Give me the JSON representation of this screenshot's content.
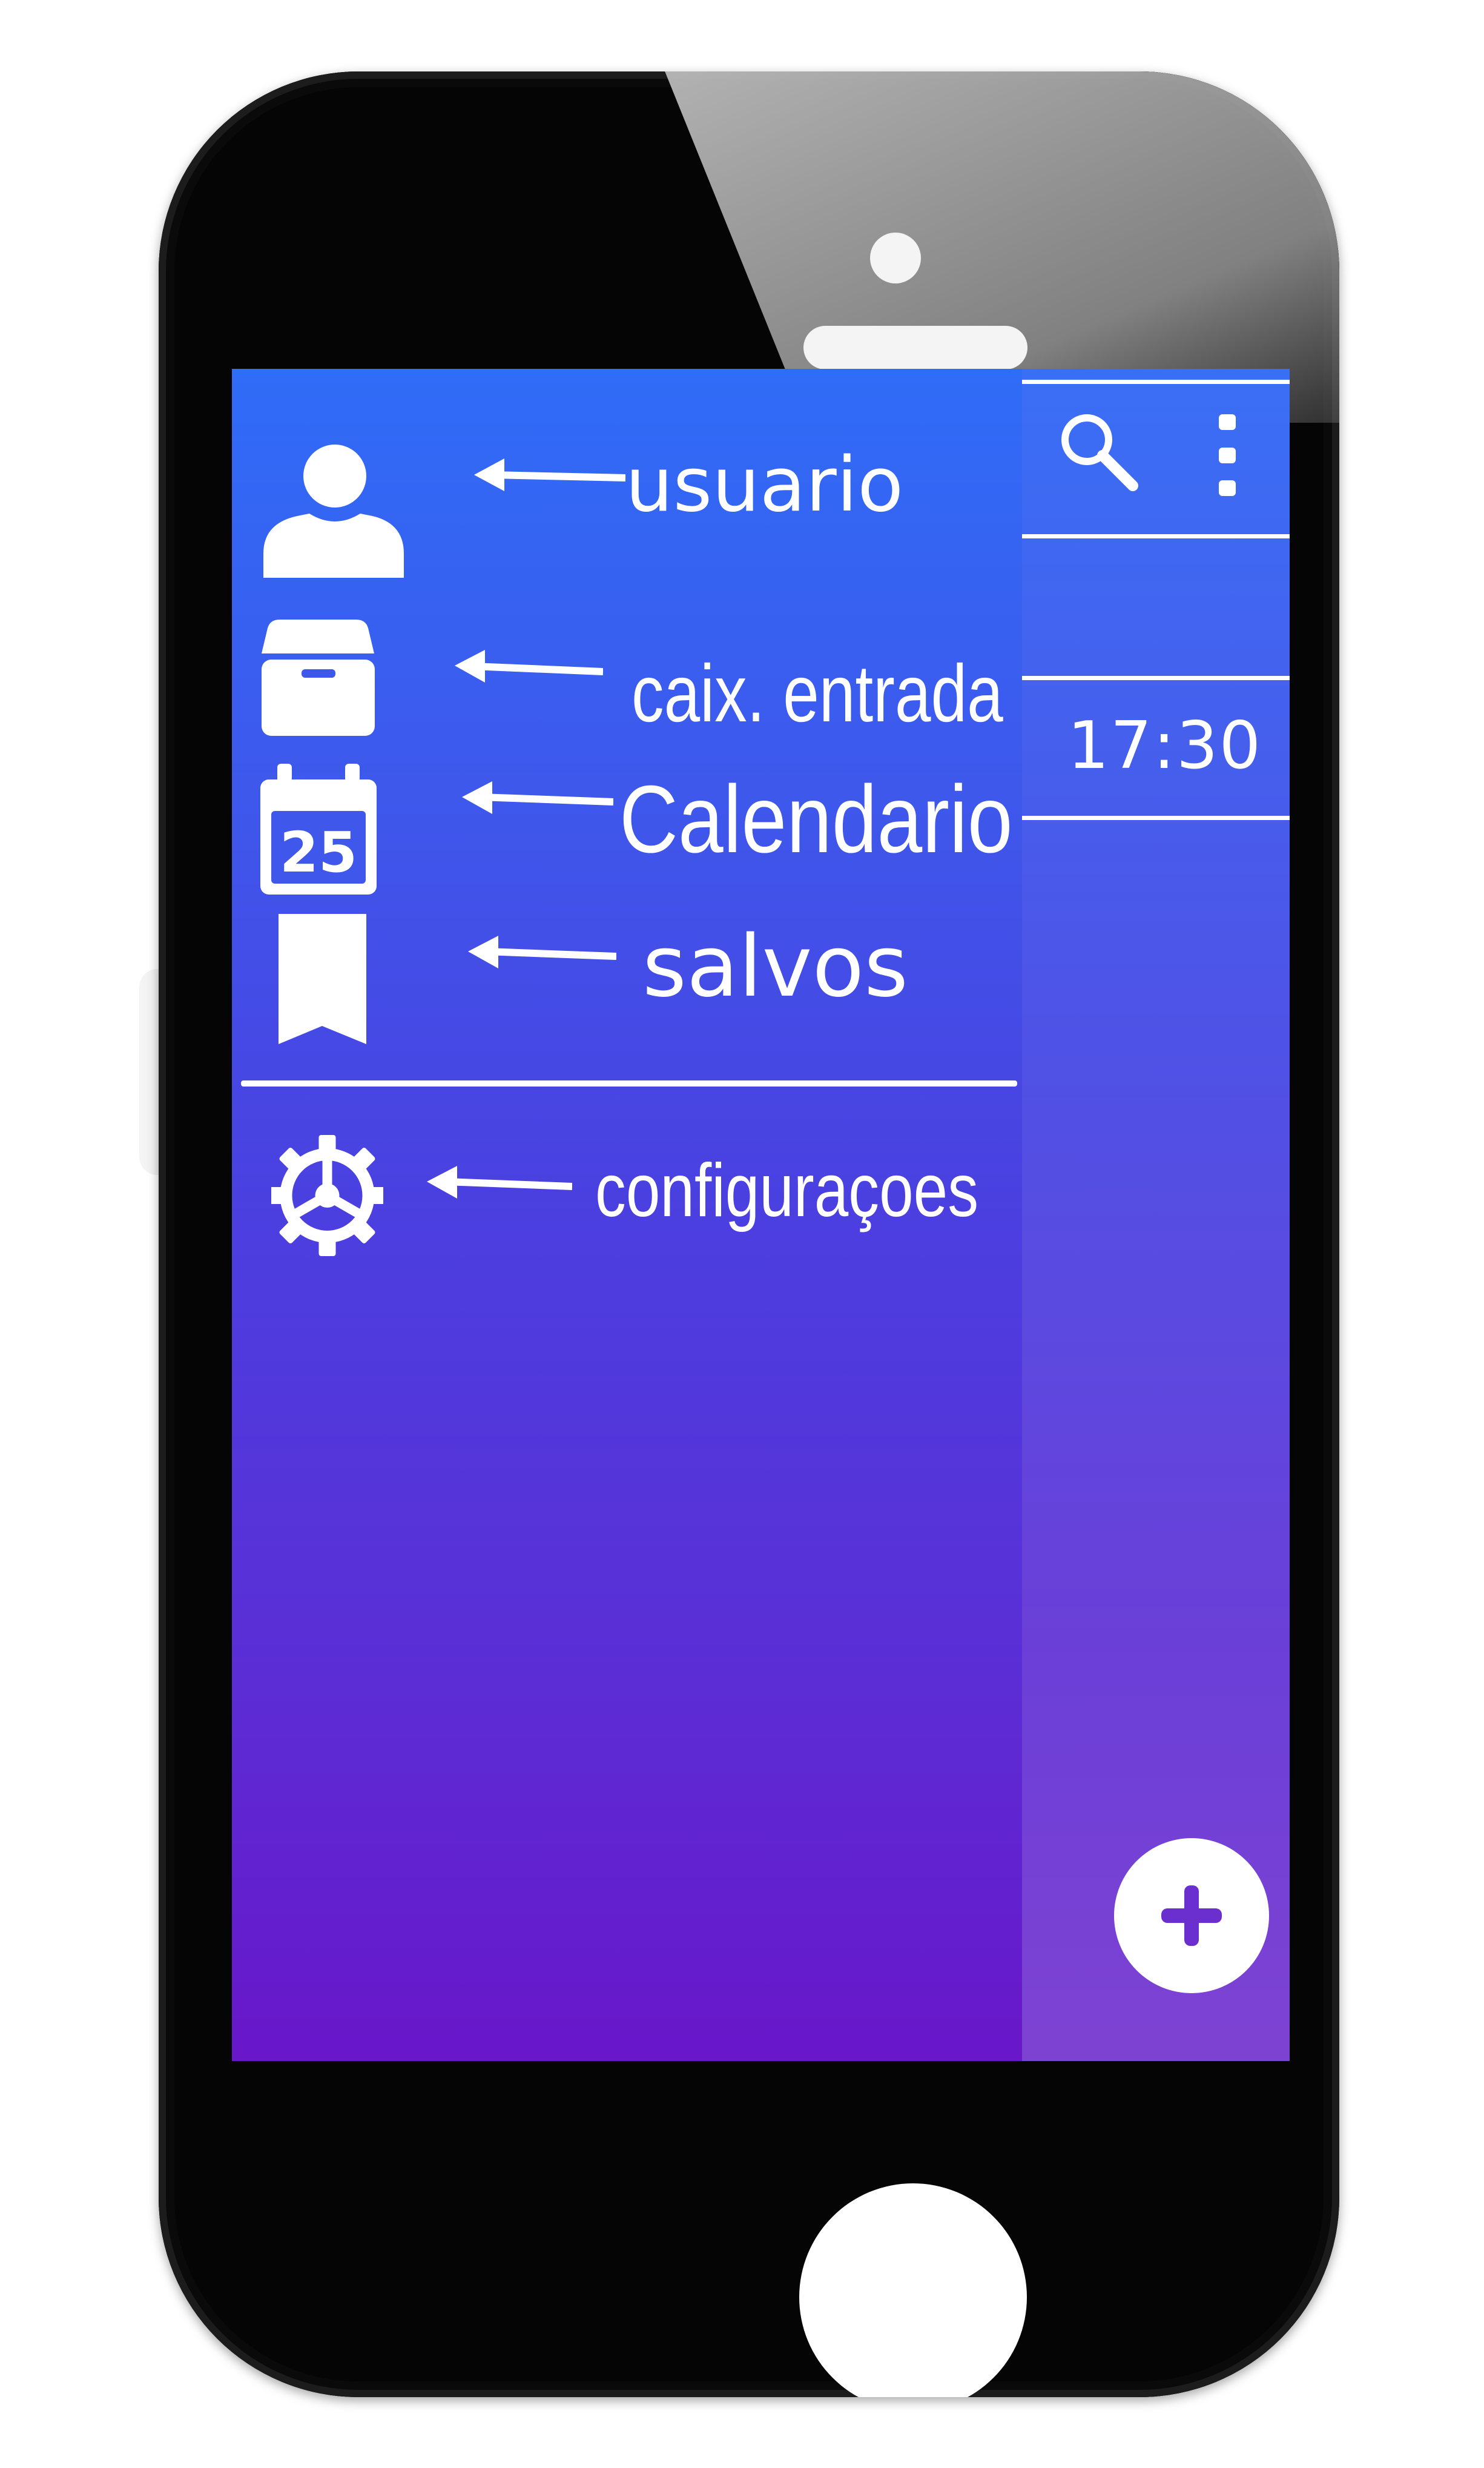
{
  "drawer": {
    "items": [
      {
        "label": "usuario",
        "icon": "user-icon"
      },
      {
        "label": "caix. entrada",
        "icon": "inbox-box-icon"
      },
      {
        "label": "Calendario",
        "icon": "calendar-icon",
        "icon_text": "25"
      },
      {
        "label": "salvos",
        "icon": "bookmark-icon"
      }
    ],
    "footer_items": [
      {
        "label": "configuraçoes",
        "icon": "gear-icon"
      }
    ]
  },
  "app": {
    "toolbar": {
      "search_icon": "search-icon",
      "more_icon": "more-vertical-icon"
    },
    "time": "17:30",
    "fab_icon": "plus-icon"
  },
  "colors": {
    "gradient_top": "#2f6cf7",
    "gradient_bottom": "#6817c9",
    "fab_icon": "#6b2fcf",
    "phone_body": "#050505"
  }
}
